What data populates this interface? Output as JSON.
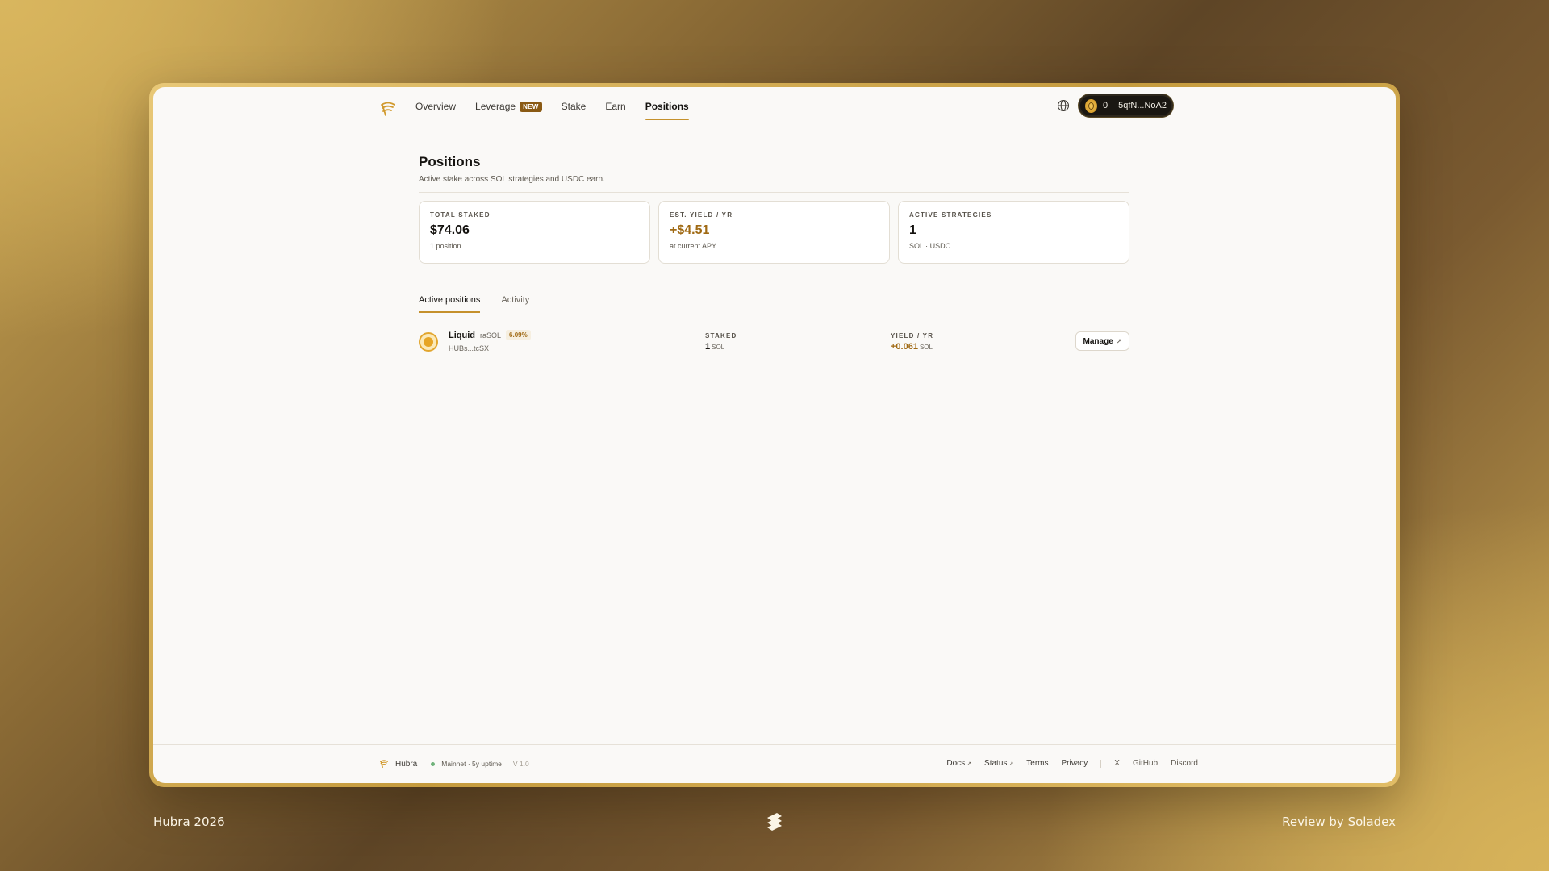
{
  "nav": {
    "links": [
      "Overview",
      "Leverage",
      "Stake",
      "Earn",
      "Positions"
    ],
    "leverage_badge": "NEW",
    "active": "Positions",
    "wallet": {
      "count": "0",
      "address": "5qfN...NoA2"
    }
  },
  "page": {
    "title": "Positions",
    "subtitle": "Active stake across SOL strategies and USDC earn."
  },
  "cards": [
    {
      "label": "TOTAL STAKED",
      "value": "$74.06",
      "sub": "1 position"
    },
    {
      "label": "EST. YIELD / YR",
      "value": "+$4.51",
      "sub": "at current APY"
    },
    {
      "label": "ACTIVE STRATEGIES",
      "value": "1",
      "sub": "SOL · USDC"
    }
  ],
  "tabs": [
    "Active positions",
    "Activity"
  ],
  "position": {
    "name": "Liquid",
    "symbol": "raSOL",
    "apy": "6.09%",
    "address": "HUBs...tcSX",
    "staked_label": "STAKED",
    "staked_value": "1",
    "staked_unit": "SOL",
    "yield_label": "YIELD / YR",
    "yield_value": "+0.061",
    "yield_unit": "SOL",
    "manage_label": "Manage"
  },
  "footer": {
    "brand": "Hubra",
    "network": "Mainnet · 5y uptime",
    "version": "V 1.0",
    "links": [
      "Docs",
      "Status",
      "Terms",
      "Privacy",
      "X",
      "GitHub",
      "Discord"
    ]
  },
  "captions": {
    "left": "Hubra 2026",
    "right": "Review by Soladex"
  },
  "colors": {
    "accent": "#c5912c",
    "gold_text": "#a06a14",
    "background": "#faf9f7"
  }
}
